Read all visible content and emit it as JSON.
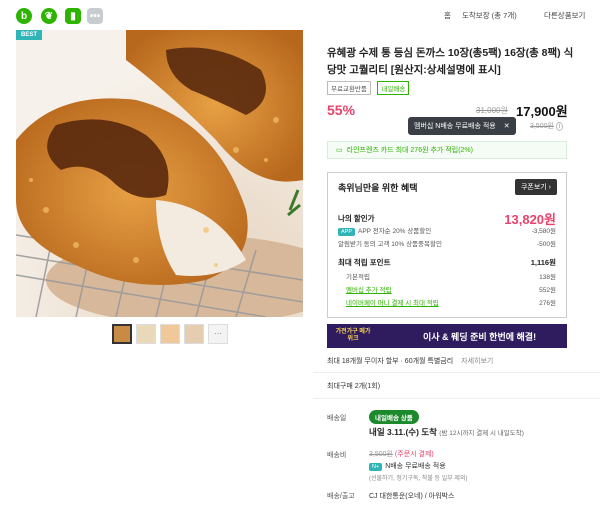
{
  "topbar": {
    "icons": [
      "b-app-icon",
      "leaf-icon",
      "bookmark-icon",
      "more-icon"
    ],
    "right_items": [
      "홈",
      "도착보장 (총 7개)",
      "다른상품보기"
    ]
  },
  "product": {
    "badge": "BEST",
    "title": "유혜광 수제 통 등심 돈까스 10장(총5팩) 16장(총 8팩) 식당맛 고퀄리티 [원산지:상세설명에 표시]",
    "tags": [
      "무료교환반품",
      "내일배송"
    ],
    "discount_pct": "55%",
    "original_price": "31,000원",
    "sale_price": "17,900원",
    "tooltip": "멤버십 N배송 무료배송 적용",
    "coupon_note": "3,500원",
    "point_bar": "라인프렌즈 카드 최대 276원 추가 적립(2%)"
  },
  "benefit": {
    "header": "촉위님만을 위한 혜택",
    "coupon_button": "쿠폰보기",
    "my_price_label": "나의 할인가",
    "my_price": "13,820원",
    "rows": [
      {
        "label": "APP 전자순 20% 상품할인",
        "value": "-3,580원"
      },
      {
        "label": "알림받기 동의 고객 10% 상품중복할인",
        "value": "-500원"
      }
    ],
    "points_label": "최대 적립 포인트",
    "points_value": "1,116원",
    "point_rows": [
      {
        "label": "기본적립",
        "value": "138원"
      },
      {
        "label": "멤버십 추가 적립",
        "value": "552원"
      },
      {
        "label": "네이버페이 머니 결제 시 최대 적립",
        "value": "276원"
      }
    ]
  },
  "banner": {
    "logo": "가전가구 메가위크",
    "text": "이사 & 웨딩 준비 한번에 해결!"
  },
  "installment": {
    "text": "최대 18개월 무이자 할부 · 60개월 특별금리",
    "link": "자세히보기"
  },
  "max_purchase": "최대구매 2개(1회)",
  "shipping": {
    "label": "배송일",
    "badge": "내일배송 상품",
    "date": "내일 3.11.(수) 도착",
    "date_note": "(밤 12시까지 결제 시 내일도착)",
    "fee_label": "배송비",
    "fee_struck": "3,500원",
    "fee_note": "(주문시 결제)",
    "member_note": "N배송 무료배송 적용",
    "member_sub": "(선물하기, 정기구독, 착불 등 일부 제외)",
    "carrier_label": "배송/출고",
    "carrier": "CJ 대한통운(오네) / 아워박스"
  },
  "colors": {
    "accent": "#e8436b",
    "brand": "#2db400",
    "banner": "#2e1c5e"
  }
}
